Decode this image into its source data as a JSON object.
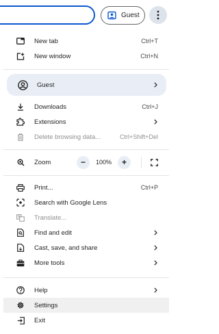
{
  "toolbar": {
    "profile_chip_label": "Guest"
  },
  "menu": {
    "new_tab": {
      "label": "New tab",
      "shortcut": "Ctrl+T"
    },
    "new_window": {
      "label": "New window",
      "shortcut": "Ctrl+N"
    },
    "guest": {
      "label": "Guest"
    },
    "downloads": {
      "label": "Downloads",
      "shortcut": "Ctrl+J"
    },
    "extensions": {
      "label": "Extensions"
    },
    "delete_browsing_data": {
      "label": "Delete browsing data...",
      "shortcut": "Ctrl+Shift+Del"
    },
    "zoom": {
      "label": "Zoom",
      "minus": "−",
      "value": "100%",
      "plus": "+"
    },
    "print": {
      "label": "Print...",
      "shortcut": "Ctrl+P"
    },
    "search_lens": {
      "label": "Search with Google Lens"
    },
    "translate": {
      "label": "Translate..."
    },
    "find_edit": {
      "label": "Find and edit"
    },
    "cast_save_share": {
      "label": "Cast, save, and share"
    },
    "more_tools": {
      "label": "More tools"
    },
    "help": {
      "label": "Help"
    },
    "settings": {
      "label": "Settings"
    },
    "exit": {
      "label": "Exit"
    }
  },
  "colors": {
    "accent": "#0b57d0",
    "highlight": "#e9eef6",
    "hover": "#f0f0f0"
  }
}
